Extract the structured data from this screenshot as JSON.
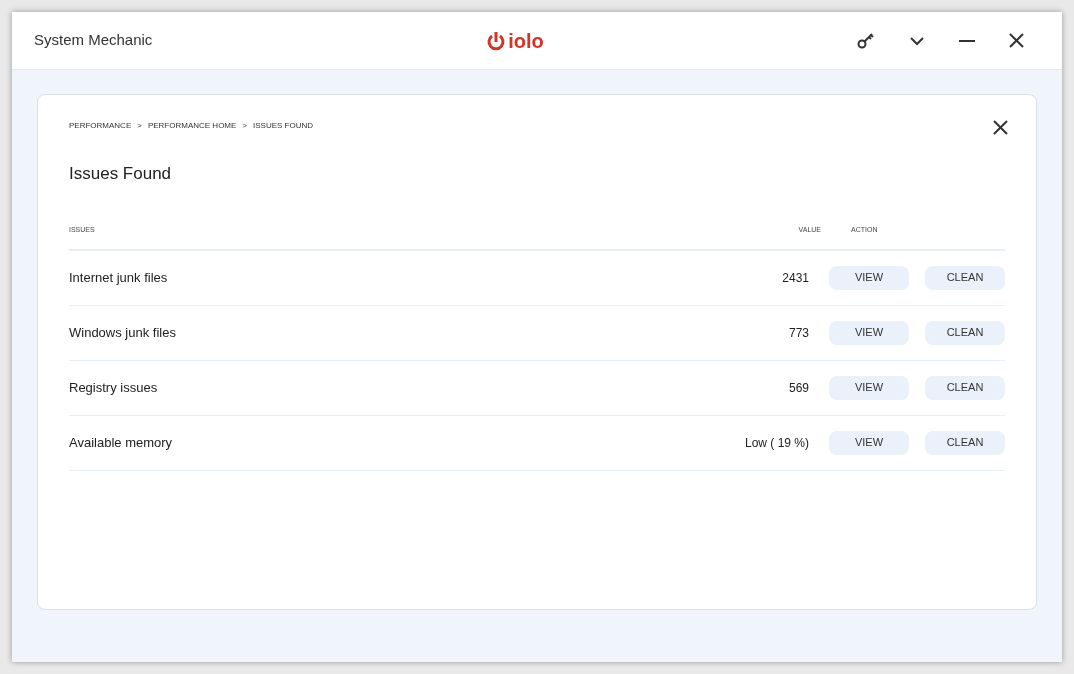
{
  "window": {
    "title": "System Mechanic",
    "logo_text": "iolo"
  },
  "breadcrumb": [
    "PERFORMANCE",
    "PERFORMANCE HOME",
    "ISSUES FOUND"
  ],
  "breadcrumb_separator": ">",
  "heading": "Issues Found",
  "table": {
    "columns": [
      "ISSUES",
      "VALUE",
      "ACTION"
    ],
    "rows": [
      {
        "issue": "Internet junk files",
        "value": "2431",
        "actions": [
          "VIEW",
          "CLEAN"
        ]
      },
      {
        "issue": "Windows junk files",
        "value": "773",
        "actions": [
          "VIEW",
          "CLEAN"
        ]
      },
      {
        "issue": "Registry issues",
        "value": "569",
        "actions": [
          "VIEW",
          "CLEAN"
        ]
      },
      {
        "issue": "Available memory",
        "value": "Low ( 19 %)",
        "actions": [
          "VIEW",
          "CLEAN"
        ]
      }
    ]
  }
}
